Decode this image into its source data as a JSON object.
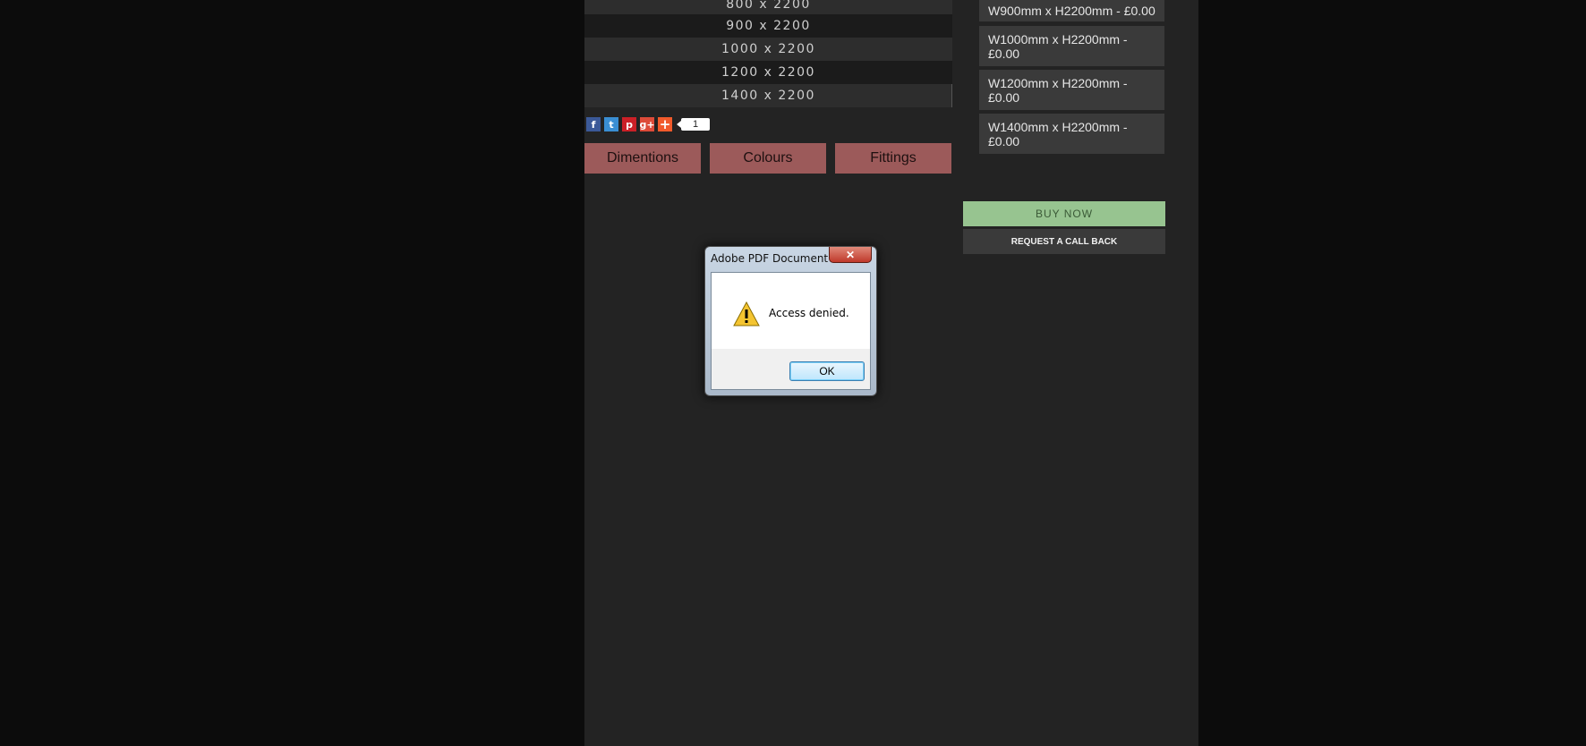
{
  "sizes": [
    "800 x 2200",
    "900 x 2200",
    "1000 x 2200",
    "1200 x 2200",
    "1400 x 2200"
  ],
  "share": {
    "count": "1"
  },
  "tabs": [
    "Dimentions",
    "Colours",
    "Fittings"
  ],
  "options": [
    "W900mm x H2200mm - £0.00",
    "W1000mm x H2200mm - £0.00",
    "W1200mm x H2200mm - £0.00",
    "W1400mm x H2200mm - £0.00"
  ],
  "buy_now": "BUY NOW",
  "request_callback": "REQUEST A CALL BACK",
  "dialog": {
    "title": "Adobe PDF Document",
    "message": "Access denied.",
    "ok": "OK"
  },
  "colors": {
    "tab": "#9c5a5a",
    "buy": "#97c490",
    "page": "#232323",
    "background": "#0c0c0c"
  }
}
